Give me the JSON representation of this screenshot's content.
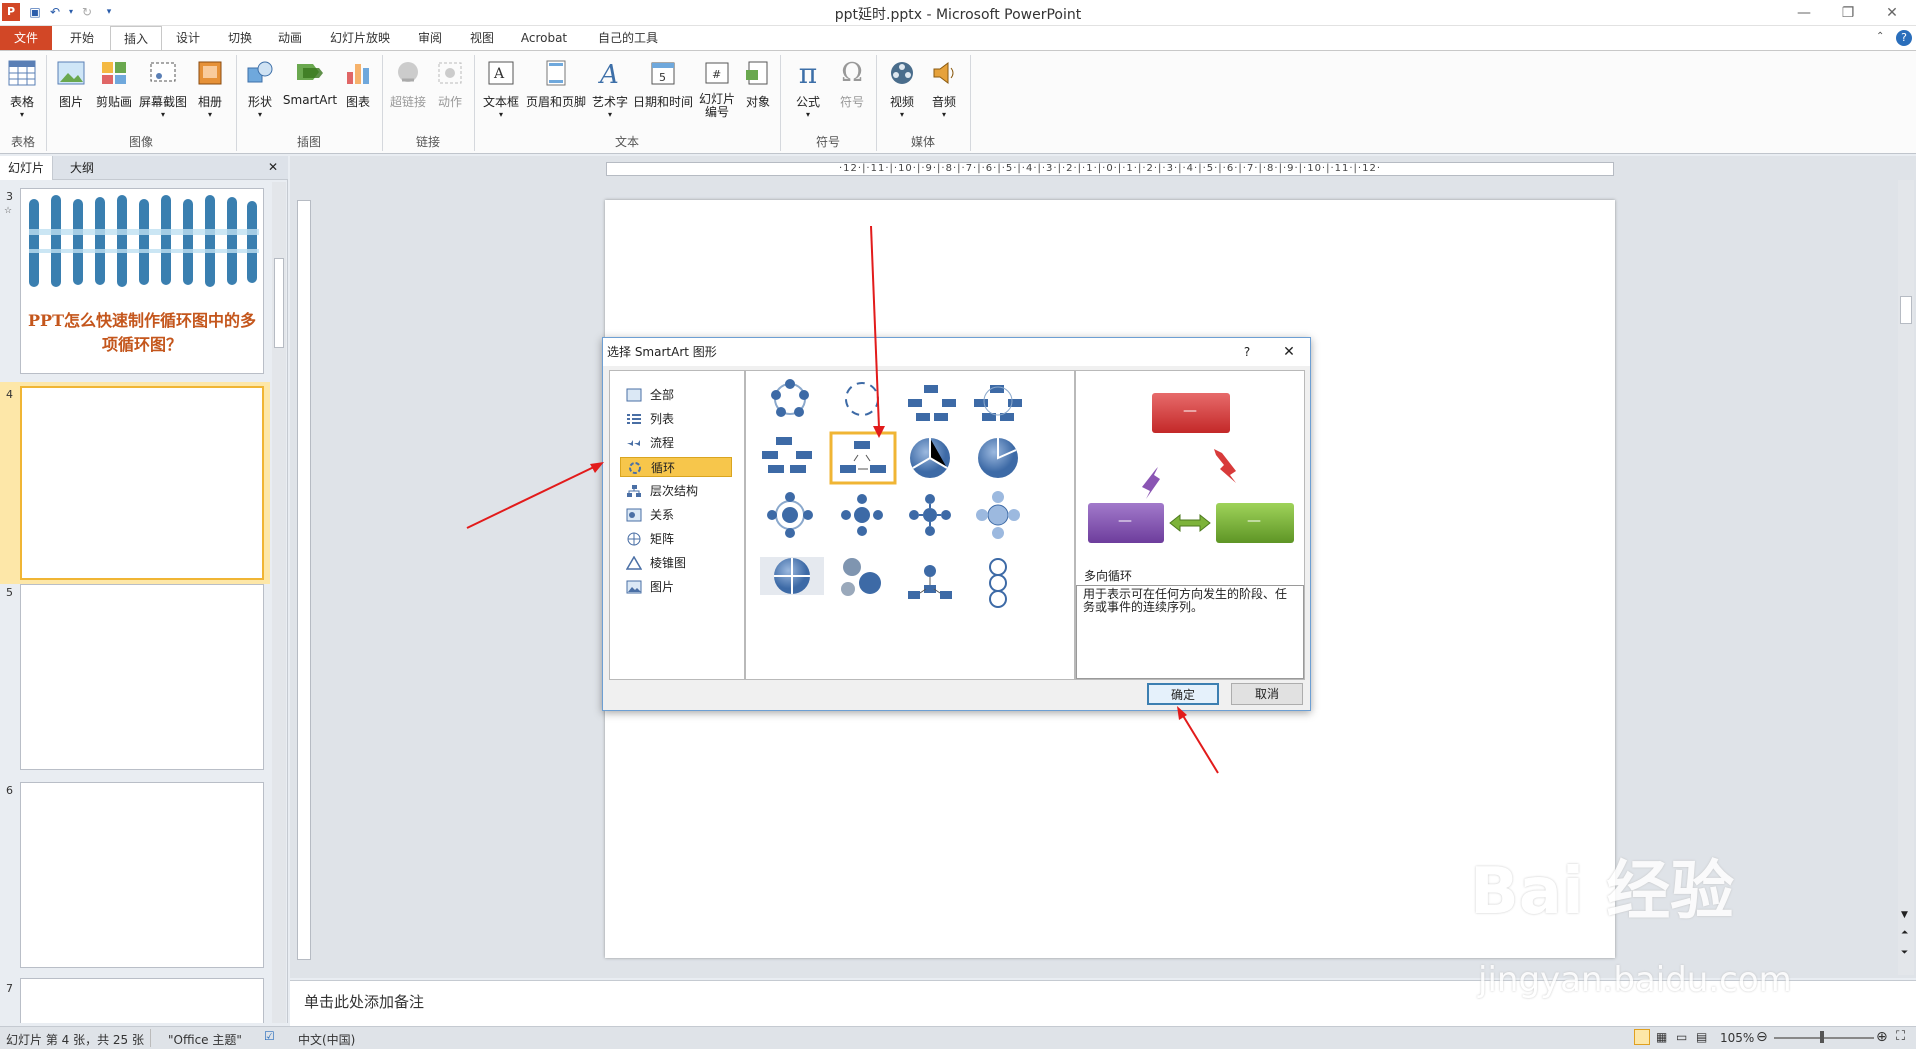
{
  "window": {
    "title": "ppt延时.pptx  -  Microsoft PowerPoint"
  },
  "tabs": [
    "文件",
    "开始",
    "插入",
    "设计",
    "切换",
    "动画",
    "幻灯片放映",
    "审阅",
    "视图",
    "Acrobat",
    "自己的工具"
  ],
  "ribbon": {
    "buttons": {
      "table": "表格",
      "picture": "图片",
      "clipart": "剪贴画",
      "screenshot": "屏幕截图",
      "album": "相册",
      "shapes": "形状",
      "smartart": "SmartArt",
      "chart": "图表",
      "hyperlink": "超链接",
      "action": "动作",
      "textbox": "文本框",
      "header_footer": "页眉和页脚",
      "wordart": "艺术字",
      "datetime": "日期和时间",
      "slidenum_1": "幻灯片",
      "slidenum_2": "编号",
      "object": "对象",
      "equation": "公式",
      "symbol": "符号",
      "video": "视频",
      "audio": "音频"
    },
    "groups": {
      "table": "表格",
      "image": "图像",
      "illustration": "插图",
      "link": "链接",
      "text": "文本",
      "symbol": "符号",
      "media": "媒体"
    }
  },
  "left_pane": {
    "tab_slides": "幻灯片",
    "tab_outline": "大纲",
    "close": "✕"
  },
  "slides": [
    {
      "num": "3",
      "title": "PPT怎么快速制作循环图中的多项循环图？"
    },
    {
      "num": "4"
    },
    {
      "num": "5"
    },
    {
      "num": "6"
    },
    {
      "num": "7"
    }
  ],
  "ruler_labels": "·12·|·11·|·10·|·9·|·8·|·7·|·6·|·5·|·4·|·3·|·2·|·1·|·0·|·1·|·2·|·3·|·4·|·5·|·6·|·7·|·8·|·9·|·10·|·11·|·12·",
  "dialog": {
    "title": "选择 SmartArt 图形",
    "help": "?",
    "close": "✕",
    "categories": [
      "全部",
      "列表",
      "流程",
      "循环",
      "层次结构",
      "关系",
      "矩阵",
      "棱锥图",
      "图片"
    ],
    "selected_category": "循环",
    "preview_name": "多向循环",
    "preview_desc": "用于表示可在任何方向发生的阶段、任务或事件的连续序列。",
    "preview_dash": "—",
    "ok": "确定",
    "cancel": "取消"
  },
  "notes": {
    "placeholder": "单击此处添加备注"
  },
  "status": {
    "slide_info": "幻灯片 第 4 张，共 25 张",
    "theme": "\"Office 主题\"",
    "language": "中文(中国)",
    "zoom": "105%"
  },
  "watermark": {
    "brand": "Bai 经验",
    "url": "jingyan.baidu.com"
  },
  "colors": {
    "accent": "#d24726",
    "arrow": "#e21b1b",
    "selection": "#f7c64b",
    "shape_red": "#d83b3b",
    "shape_purple": "#8a55b3",
    "shape_green": "#7db33a"
  }
}
